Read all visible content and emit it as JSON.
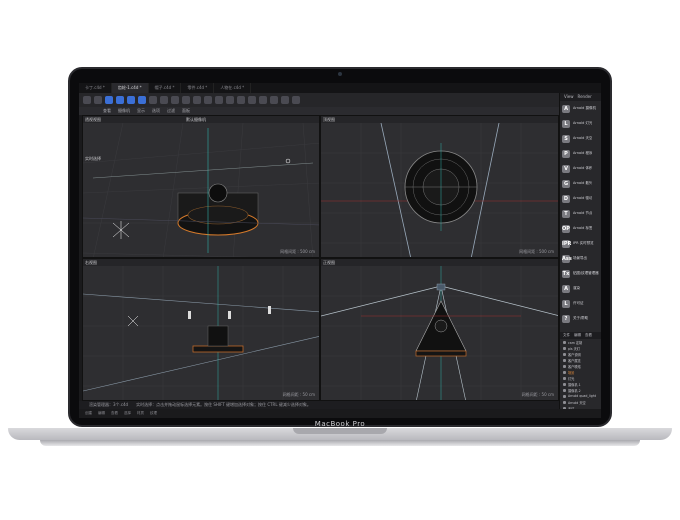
{
  "device": {
    "brand": "MacBook Pro"
  },
  "app": {
    "tabs": [
      {
        "label": "卡丁.c4d *",
        "active": false
      },
      {
        "label": "齿轮-1.c4d *",
        "active": true
      },
      {
        "label": "帽子.c4d *",
        "active": false
      },
      {
        "label": "零件.c4d *",
        "active": false
      },
      {
        "label": "人物在.c4d *",
        "active": false
      }
    ],
    "menu": [
      "查看",
      "摄像机",
      "显示",
      "选项",
      "过滤",
      "面板"
    ],
    "viewports": [
      {
        "title": "透视视图",
        "grid": "网格间距 : 500 cm"
      },
      {
        "title": "顶视图",
        "grid": "网格间距 : 500 cm"
      },
      {
        "title": "右视图",
        "grid": "网格间距 : 50 cm"
      },
      {
        "title": "正视图",
        "grid": "网格间距 : 50 cm"
      }
    ],
    "camera_label": "默认摄像机",
    "realtime_label": "实时选择",
    "status_text": "实时选择：点击并拖动鼠标选择元素。按住 SHIFT 键增加选择对象；按住 CTRL 键减少选择对象。",
    "status_left": "渲染管理器：3个.c4d",
    "right_panel": {
      "tabs": [
        "View",
        "Render"
      ],
      "items": [
        {
          "icon": "A",
          "label": "Arnold 摄像机"
        },
        {
          "icon": "L",
          "label": "Arnold 灯光"
        },
        {
          "icon": "S",
          "label": "Arnold 天空"
        },
        {
          "icon": "P",
          "label": "Arnold 程序"
        },
        {
          "icon": "V",
          "label": "Arnold 体积"
        },
        {
          "icon": "G",
          "label": "Arnold 散列"
        },
        {
          "icon": "D",
          "label": "Arnold 驱动"
        },
        {
          "icon": "T",
          "label": "Arnold 节点"
        },
        {
          "icon": "OP",
          "label": "Arnold 标签"
        },
        {
          "icon": "IPR",
          "label": "IPR 实时预览"
        },
        {
          "icon": "Ass",
          "label": "场景导出"
        },
        {
          "icon": "Tx",
          "label": "贴图/纹理管理器"
        },
        {
          "icon": "A",
          "label": "渲染"
        },
        {
          "icon": "L",
          "label": "许可证"
        },
        {
          "icon": "?",
          "label": "关于/帮助"
        }
      ],
      "objects_tabs": [
        "文件",
        "编辑",
        "查看"
      ],
      "objects": [
        {
          "label": "cam 定制",
          "orange": false
        },
        {
          "label": "pls 天灯",
          "orange": false
        },
        {
          "label": "客户说明",
          "orange": false
        },
        {
          "label": "客户展览",
          "orange": false
        },
        {
          "label": "客户联络",
          "orange": false
        },
        {
          "label": "场景",
          "orange": true
        },
        {
          "label": "灯光",
          "orange": false
        },
        {
          "label": "摄像机.1",
          "orange": false
        },
        {
          "label": "摄像机.2",
          "orange": false
        },
        {
          "label": "Arnold quad_light",
          "orange": false
        },
        {
          "label": "Arnold 天空",
          "orange": false
        },
        {
          "label": "天灯",
          "orange": false
        },
        {
          "label": "平面",
          "orange": false
        },
        {
          "label": "BF",
          "orange": false
        }
      ]
    },
    "bottom_menu": [
      "创建",
      "编辑",
      "查看",
      "选择",
      "材质",
      "纹理"
    ]
  }
}
